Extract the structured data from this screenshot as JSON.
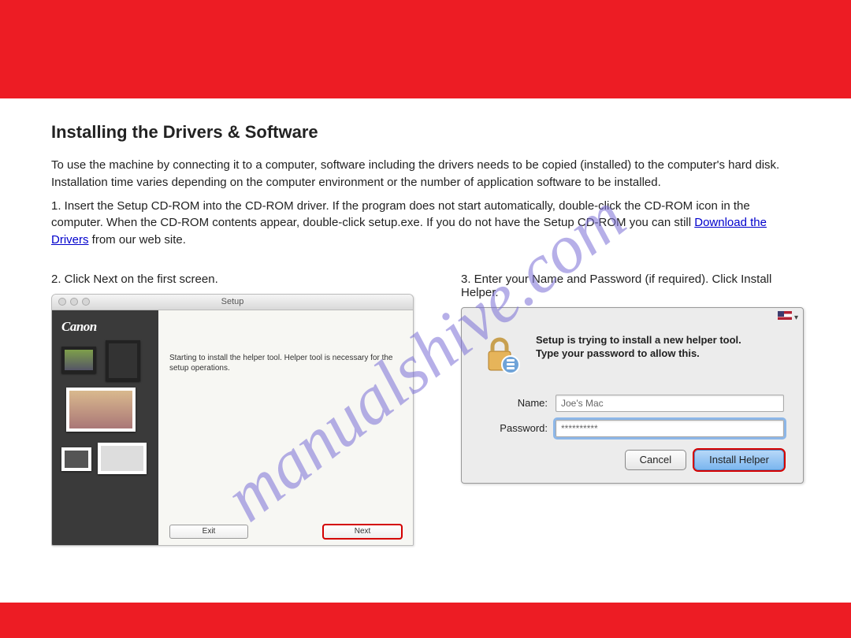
{
  "watermark": "manualshive.com",
  "header": {},
  "section": {
    "title": "Installing the Drivers & Software",
    "intro1_prefix": "To use the machine by connecting it to a computer, software including the drivers needs to be copied (installed) to the computer's hard disk. Installation time varies depending on the computer environment or the number of application software to be installed. ",
    "insert_prefix": "1. Insert the Setup CD-ROM into the CD-ROM driver. If the program does not start automatically, double-click the CD-ROM icon in the computer. When the CD-ROM contents appear, double-click setup.exe. If you do not have the Setup CD-ROM you can still ",
    "insert_suffix": " from our web site.",
    "download_link_text": "Download the Drivers",
    "step2": "2. Click Next on the first screen.",
    "step3": "3. Enter your Name and Password (if required). Click Install Helper."
  },
  "setupWindow": {
    "title": "Setup",
    "brand": "Canon",
    "message": "Starting to install the helper tool. Helper tool is necessary for the setup operations.",
    "exit": "Exit",
    "next": "Next"
  },
  "authDialog": {
    "heading1": "Setup is trying to install a new helper tool.",
    "heading2": "Type your password to allow this.",
    "nameLabel": "Name:",
    "nameValue": "Joe's Mac",
    "passwordLabel": "Password:",
    "passwordValue": "**********",
    "cancel": "Cancel",
    "install": "Install Helper"
  }
}
